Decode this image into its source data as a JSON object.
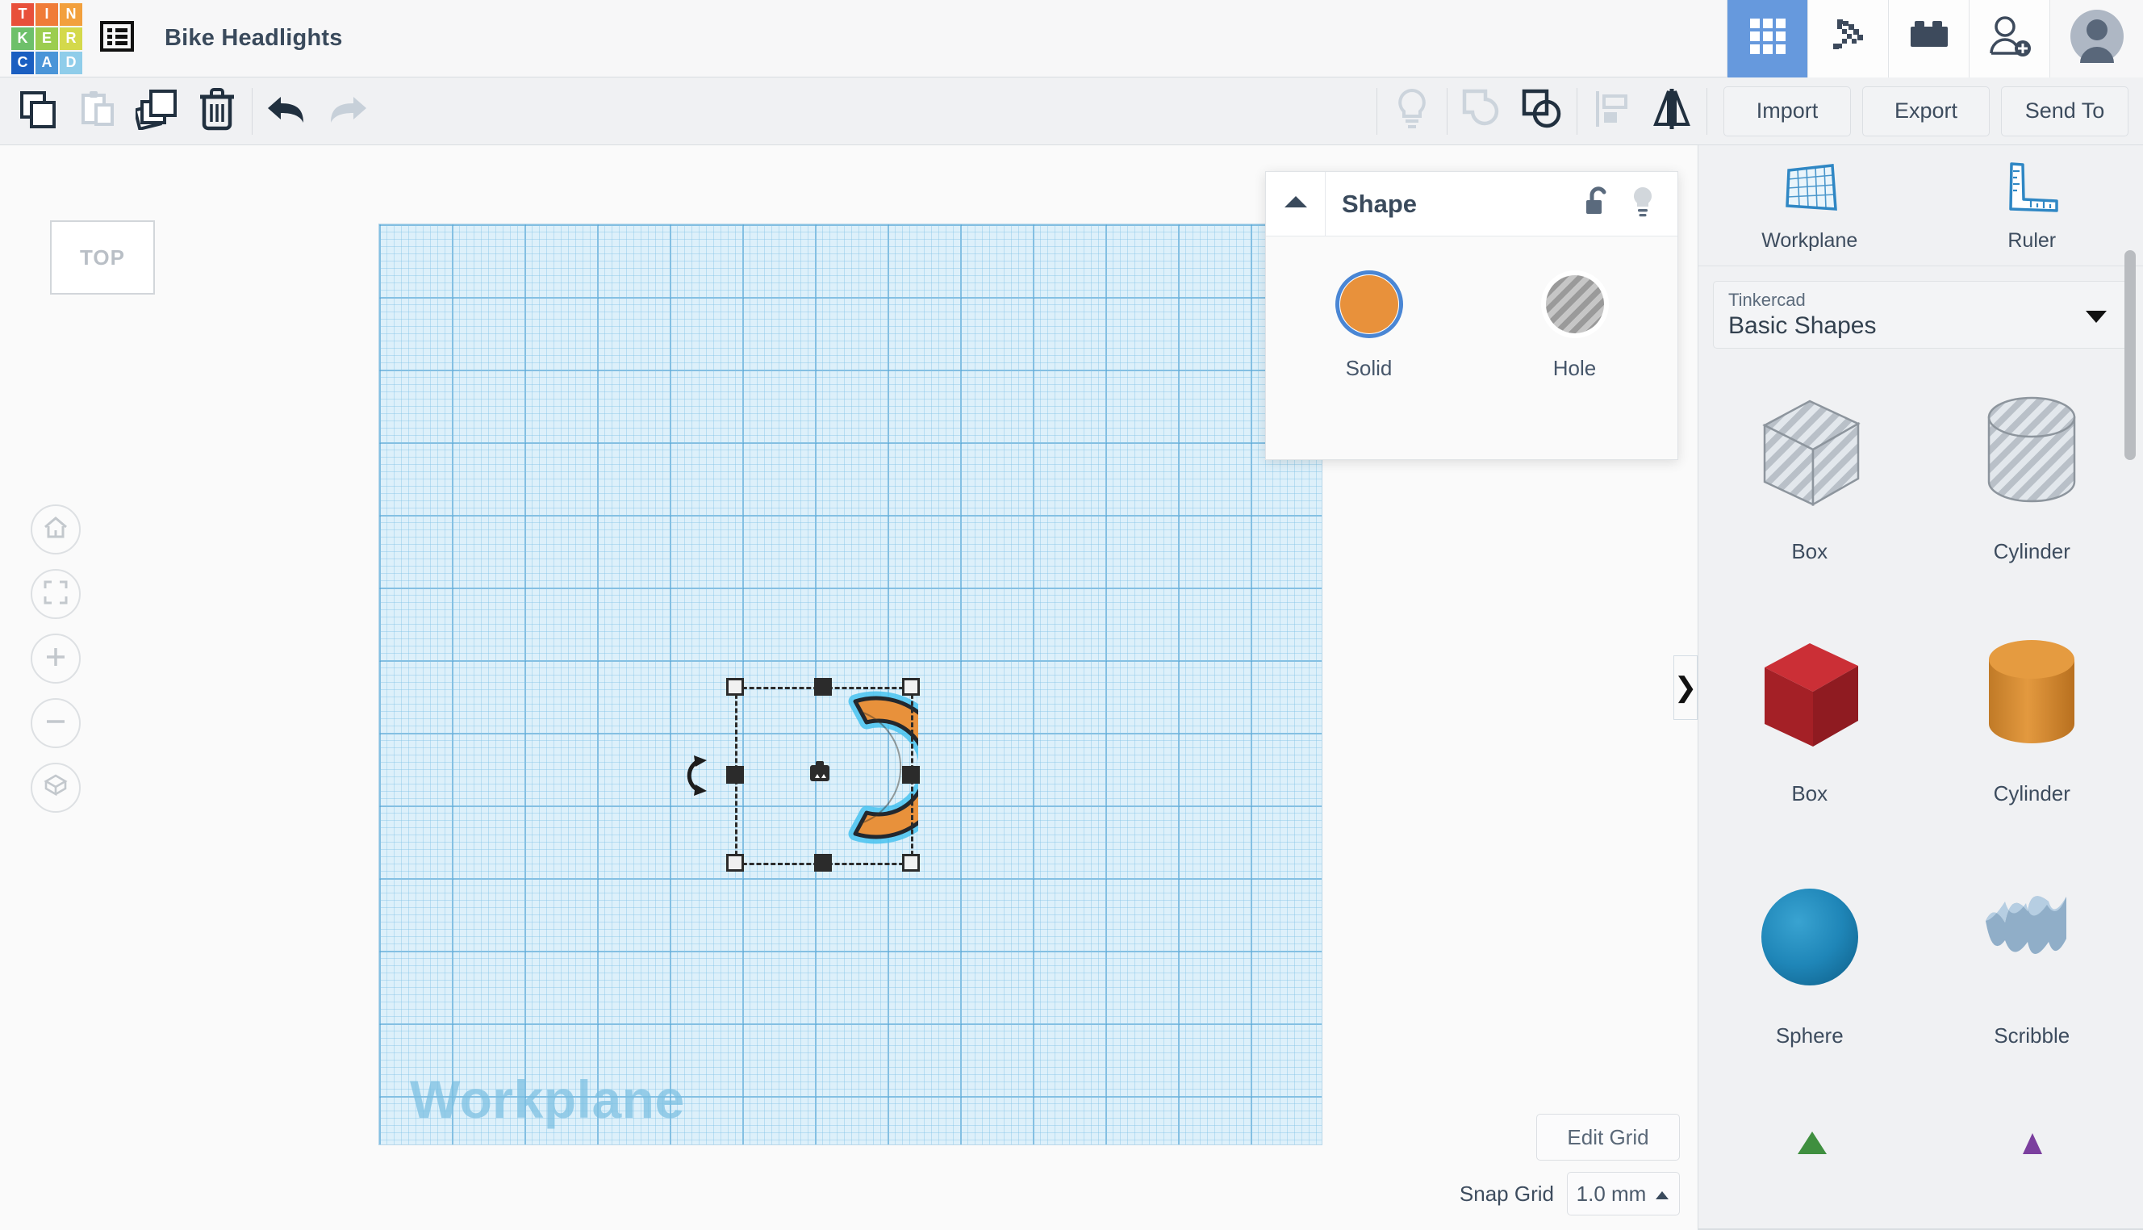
{
  "header": {
    "logo_letters": [
      "T",
      "I",
      "N",
      "K",
      "E",
      "R",
      "C",
      "A",
      "D"
    ],
    "logo_colors": [
      "#e8503a",
      "#f07c38",
      "#f2a03d",
      "#6ec06a",
      "#9ccd4f",
      "#d4d94b",
      "#1b5fc1",
      "#4a95d8",
      "#8fcdea"
    ],
    "doc_icon": "list-icon",
    "title": "Bike Headlights",
    "right_buttons": [
      {
        "name": "blocks-3d-icon",
        "label": "3D Design",
        "active": true
      },
      {
        "name": "minecraft-pickaxe-icon",
        "label": "Minecraft",
        "active": false
      },
      {
        "name": "lego-brick-icon",
        "label": "Bricks",
        "active": false
      },
      {
        "name": "invite-person-icon",
        "label": "Invite",
        "active": false
      },
      {
        "name": "avatar",
        "label": "Account",
        "active": false
      }
    ]
  },
  "toolbar": {
    "left_buttons": [
      {
        "name": "copy-icon",
        "label": "Copy",
        "enabled": true
      },
      {
        "name": "paste-icon",
        "label": "Paste",
        "enabled": false
      },
      {
        "name": "duplicate-icon",
        "label": "Duplicate",
        "enabled": true
      },
      {
        "name": "delete-icon",
        "label": "Delete",
        "enabled": true
      },
      {
        "name": "undo-icon",
        "label": "Undo",
        "enabled": true
      },
      {
        "name": "redo-icon",
        "label": "Redo",
        "enabled": false
      }
    ],
    "right_buttons": [
      {
        "name": "lightbulb-icon",
        "label": "Notes",
        "enabled": false
      },
      {
        "name": "group-icon",
        "label": "Group",
        "enabled": false
      },
      {
        "name": "ungroup-icon",
        "label": "Ungroup",
        "enabled": true
      },
      {
        "name": "align-icon",
        "label": "Align",
        "enabled": false
      },
      {
        "name": "mirror-icon",
        "label": "Mirror",
        "enabled": true
      }
    ],
    "import_label": "Import",
    "export_label": "Export",
    "send_to_label": "Send To"
  },
  "canvas": {
    "view_cube_label": "TOP",
    "workplane_label": "Workplane",
    "nav_buttons": [
      {
        "name": "home-view-icon",
        "label": "Home View"
      },
      {
        "name": "fit-all-icon",
        "label": "Fit All in View"
      },
      {
        "name": "zoom-in-icon",
        "label": "Zoom In"
      },
      {
        "name": "zoom-out-icon",
        "label": "Zoom Out"
      },
      {
        "name": "orthographic-toggle-icon",
        "label": "Switch to Orthographic/Perspective View"
      }
    ],
    "selected_shape": {
      "name": "partial-torus-shape",
      "color": "#e8913b",
      "outline_color": "#2b2b2b",
      "glow_color": "#49c3f0"
    },
    "edit_grid_label": "Edit Grid",
    "snap_grid_label": "Snap Grid",
    "snap_grid_value": "1.0 mm"
  },
  "shape_popup": {
    "title": "Shape",
    "collapse_icon": "triangle-up-icon",
    "header_icons": [
      {
        "name": "unlock-icon",
        "label": "Lock"
      },
      {
        "name": "lightbulb-icon",
        "label": "Hide"
      }
    ],
    "options": [
      {
        "name": "solid-swatch",
        "label": "Solid",
        "color": "#e8913b",
        "selected": true
      },
      {
        "name": "hole-swatch",
        "label": "Hole",
        "color": "#a8a8a8",
        "selected": false
      }
    ]
  },
  "sidebar": {
    "tools": [
      {
        "name": "workplane-tool",
        "label": "Workplane"
      },
      {
        "name": "ruler-tool",
        "label": "Ruler"
      }
    ],
    "library_source": "Tinkercad",
    "library_name": "Basic Shapes",
    "shapes": [
      {
        "name": "box-hole-shape",
        "label": "Box",
        "kind": "box",
        "color": "#c9ced4",
        "hatched": true
      },
      {
        "name": "cylinder-hole-shape",
        "label": "Cylinder",
        "kind": "cylinder",
        "color": "#c9ced4",
        "hatched": true
      },
      {
        "name": "box-solid-shape",
        "label": "Box",
        "kind": "box",
        "color": "#b62a30",
        "hatched": false
      },
      {
        "name": "cylinder-solid-shape",
        "label": "Cylinder",
        "kind": "cylinder",
        "color": "#d98a33",
        "hatched": false
      },
      {
        "name": "sphere-shape",
        "label": "Sphere",
        "kind": "sphere",
        "color": "#1f86b8",
        "hatched": false
      },
      {
        "name": "scribble-shape",
        "label": "Scribble",
        "kind": "scribble",
        "color": "#a8c2d9",
        "hatched": false
      }
    ],
    "partial_row": [
      {
        "name": "roof-shape",
        "color": "#3f8f3f"
      },
      {
        "name": "pyramid-shape",
        "color": "#7b3f9e"
      }
    ]
  },
  "panel_handle": {
    "name": "collapse-panel-handle",
    "glyph": "❯"
  }
}
